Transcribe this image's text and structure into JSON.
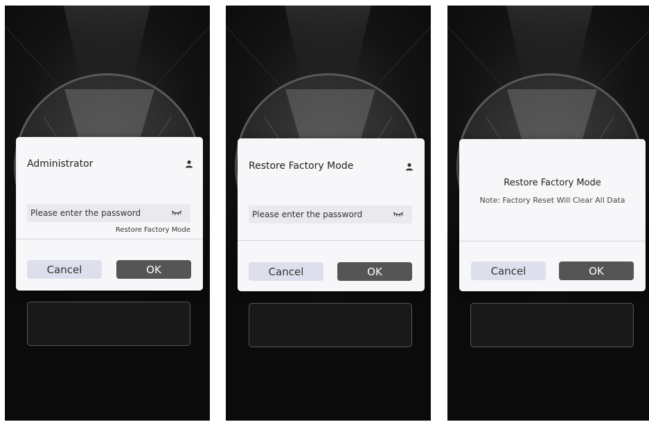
{
  "screens": [
    {
      "title": "Administrator",
      "password_placeholder": "Please enter the password",
      "link_label": "Restore Factory Mode",
      "cancel_label": "Cancel",
      "ok_label": "OK"
    },
    {
      "title": "Restore Factory Mode",
      "password_placeholder": "Please enter the password",
      "cancel_label": "Cancel",
      "ok_label": "OK"
    },
    {
      "title": "Restore Factory Mode",
      "note": "Note: Factory Reset Will Clear All Data",
      "cancel_label": "Cancel",
      "ok_label": "OK"
    }
  ],
  "icons": {
    "user": "user-icon",
    "eye_closed": "eye-closed-icon"
  },
  "colors": {
    "dialog_bg": "#f7f7f9",
    "cancel_button": "#dde0ec",
    "ok_button": "#555555",
    "screen_bg": "#111111"
  }
}
